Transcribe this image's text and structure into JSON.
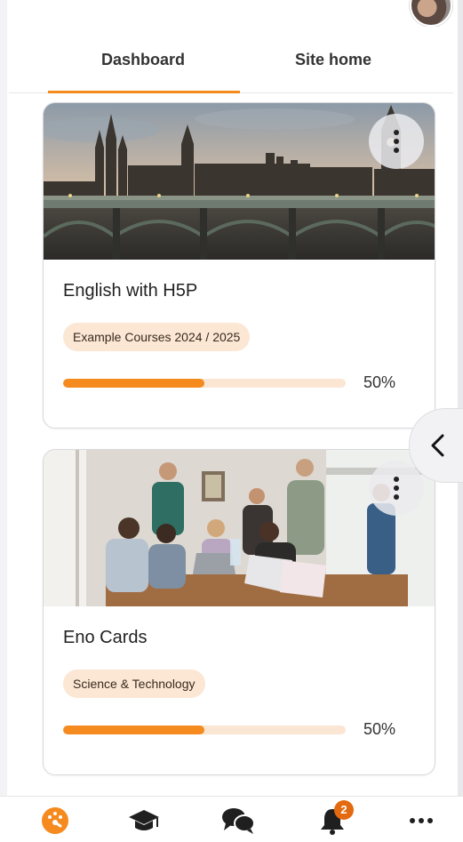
{
  "tabs": {
    "items": [
      {
        "label": "Dashboard",
        "active": true
      },
      {
        "label": "Site home",
        "active": false
      }
    ]
  },
  "courses": [
    {
      "title": "English with H5P",
      "category": "Example Courses 2024 / 2025",
      "progress_percent": 50,
      "progress_label": "50%",
      "image": "london-bridge-parliament"
    },
    {
      "title": "Eno Cards",
      "category": "Science & Technology",
      "progress_percent": 50,
      "progress_label": "50%",
      "image": "students-working-laptops"
    }
  ],
  "bottom_nav": {
    "items": [
      {
        "icon": "dashboard-gauge-icon",
        "active": true
      },
      {
        "icon": "courses-graduation-cap-icon",
        "active": false
      },
      {
        "icon": "messages-chat-icon",
        "active": false
      },
      {
        "icon": "notifications-bell-icon",
        "active": false,
        "badge": "2"
      },
      {
        "icon": "more-dots-icon",
        "active": false
      }
    ]
  },
  "colors": {
    "accent": "#f58a1f",
    "badge_bg": "#fbe7d4",
    "progress_track": "#fbe6d3",
    "notification_badge": "#e36a10"
  }
}
